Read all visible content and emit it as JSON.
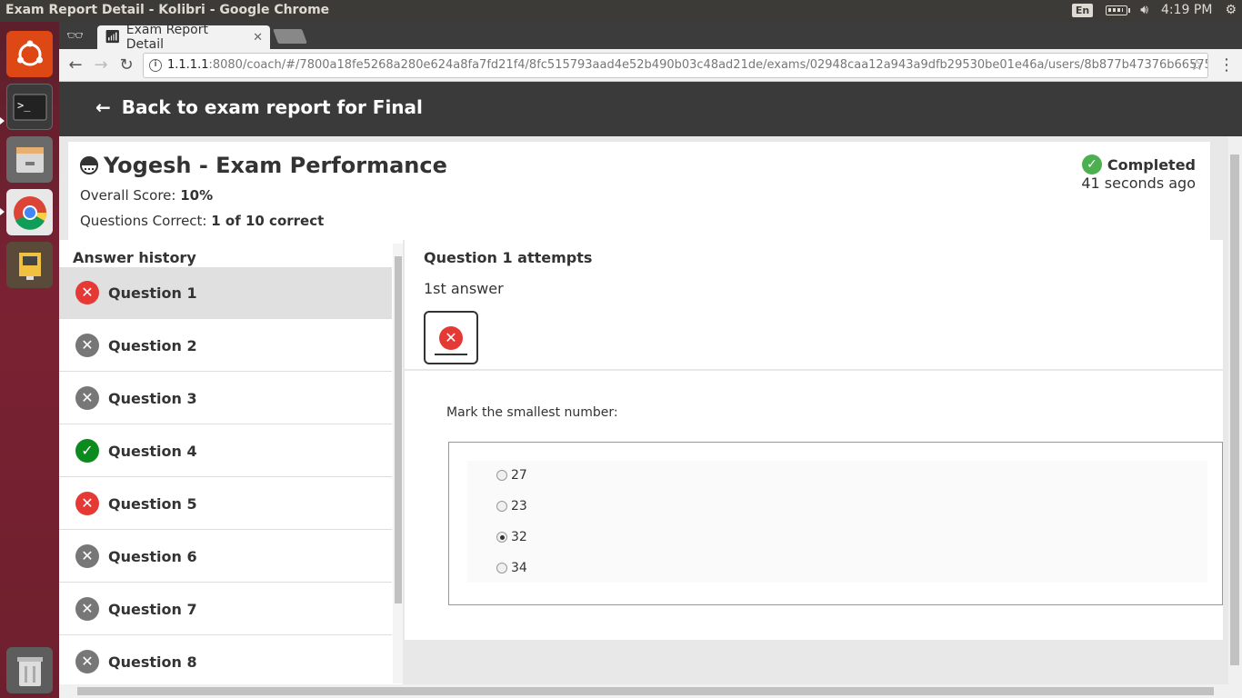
{
  "os": {
    "window_title": "Exam Report Detail - Kolibri - Google Chrome",
    "lang": "En",
    "time": "4:19 PM"
  },
  "browser": {
    "tab_title": "Exam Report Detail",
    "url_host": "1.1.1.1",
    "url_rest": ":8080/coach/#/7800a18fe5268a280e624a8fa7fd21f4/8fc515793aad4e52b490b03c48ad21de/exams/02948caa12a943a9dfb29530be01e46a/users/8b877b47376b66575ca"
  },
  "appbar": {
    "back_label": "Back to exam report for Final"
  },
  "learner": {
    "title": "Yogesh - Exam Performance",
    "score_label": "Overall Score: ",
    "score_value": "10%",
    "correct_label": "Questions Correct: ",
    "correct_value": "1 of 10 correct",
    "status": "Completed",
    "status_time": "41 seconds ago"
  },
  "history": {
    "heading": "Answer history",
    "items": [
      {
        "label": "Question 1",
        "result": "incorrect"
      },
      {
        "label": "Question 2",
        "result": "unanswered"
      },
      {
        "label": "Question 3",
        "result": "unanswered"
      },
      {
        "label": "Question 4",
        "result": "correct"
      },
      {
        "label": "Question 5",
        "result": "incorrect"
      },
      {
        "label": "Question 6",
        "result": "unanswered"
      },
      {
        "label": "Question 7",
        "result": "unanswered"
      },
      {
        "label": "Question 8",
        "result": "unanswered"
      }
    ]
  },
  "attempts": {
    "heading": "Question 1 attempts",
    "attempt_label": "1st answer"
  },
  "question": {
    "prompt": "Mark the smallest number:",
    "choices": [
      "27",
      "23",
      "32",
      "34"
    ],
    "selected": "32"
  },
  "colors": {
    "incorrect": "#e53935",
    "correct": "#0b8a1e",
    "unanswered": "#777777",
    "appbar": "#3a3a3a"
  }
}
